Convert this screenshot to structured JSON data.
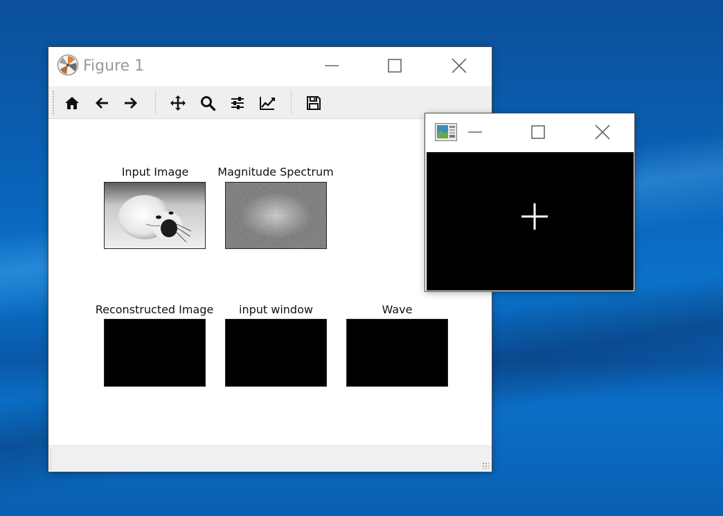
{
  "figure_window": {
    "title": "Figure 1",
    "toolbar": {
      "buttons": [
        {
          "name": "home",
          "icon": "home-icon"
        },
        {
          "name": "back",
          "icon": "arrow-left-icon"
        },
        {
          "name": "forward",
          "icon": "arrow-right-icon"
        },
        {
          "name": "pan",
          "icon": "move-icon"
        },
        {
          "name": "zoom",
          "icon": "search-icon"
        },
        {
          "name": "configure-subplots",
          "icon": "sliders-icon"
        },
        {
          "name": "edit-axis",
          "icon": "line-chart-icon"
        },
        {
          "name": "save",
          "icon": "floppy-disk-icon"
        }
      ]
    },
    "subplots": [
      {
        "title": "Input Image",
        "content": "seal-photo"
      },
      {
        "title": "Magnitude Spectrum",
        "content": "noise-spectrum"
      },
      {
        "title": "Reconstructed Image",
        "content": "black"
      },
      {
        "title": "input window",
        "content": "black"
      },
      {
        "title": "Wave",
        "content": "black"
      }
    ]
  },
  "cv_window": {
    "title": "",
    "content": "white-plus-on-black"
  },
  "colors": {
    "desktop_blue": "#0b63b8",
    "titlebar_text": "#999999",
    "toolbar_bg": "#efefef"
  }
}
